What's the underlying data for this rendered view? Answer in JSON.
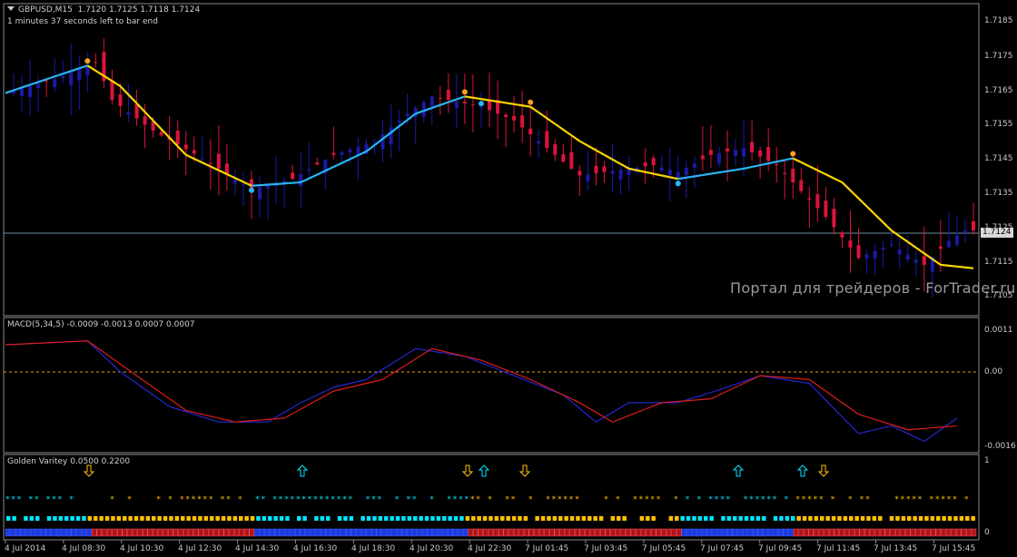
{
  "symbol_header": {
    "symbol": "GBPUSD,M15",
    "ohlc": "1.7120 1.7125 1.7118 1.7124",
    "timer": "1 minutes 37 seconds left to bar end"
  },
  "current_price": "1.7124",
  "watermark": "Портал для трейдеров - ForTrader.ru",
  "colors": {
    "background": "#000000",
    "bull_candle": "#1a1aa6",
    "bear_candle": "#dc143c",
    "ma_up": "#29b6f6",
    "ma_down": "#ffd700",
    "macd_line": "#2525d0",
    "signal_line": "#e01c1c",
    "zero_line": "#e0a020",
    "bid_line": "#6a8ca0"
  },
  "price_axis": [
    "1.7185",
    "1.7175",
    "1.7165",
    "1.7155",
    "1.7145",
    "1.7135",
    "1.7125",
    "1.7115",
    "1.7105"
  ],
  "macd_panel": {
    "label": "MACD(5,34,5) -0.0009 -0.0013 0.0007 0.0007",
    "axis": [
      "0.0011",
      "0.00",
      "-0.0016"
    ]
  },
  "golden_panel": {
    "label": "Golden Varitey 0.0500 0.2200",
    "axis": [
      "1",
      "0"
    ]
  },
  "time_axis": [
    "4 Jul 2014",
    "4 Jul 08:30",
    "4 Jul 10:30",
    "4 Jul 12:30",
    "4 Jul 14:30",
    "4 Jul 16:30",
    "4 Jul 18:30",
    "4 Jul 20:30",
    "4 Jul 22:30",
    "7 Jul 01:45",
    "7 Jul 03:45",
    "7 Jul 05:45",
    "7 Jul 07:45",
    "7 Jul 09:45",
    "7 Jul 11:45",
    "7 Jul 13:45",
    "7 Jul 15:45"
  ],
  "chart_data": {
    "type": "candlestick",
    "price_range": [
      1.7101,
      1.719
    ],
    "bars_count": 85,
    "close_path": [
      [
        0,
        1.7164
      ],
      [
        6,
        1.7168
      ],
      [
        11,
        1.7173
      ],
      [
        13,
        1.7162
      ],
      [
        18,
        1.7153
      ],
      [
        24,
        1.7145
      ],
      [
        30,
        1.7136
      ],
      [
        35,
        1.7139
      ],
      [
        40,
        1.7146
      ],
      [
        45,
        1.715
      ],
      [
        49,
        1.7158
      ],
      [
        52,
        1.7163
      ],
      [
        58,
        1.716
      ],
      [
        62,
        1.7156
      ],
      [
        66,
        1.7148
      ],
      [
        70,
        1.714
      ],
      [
        73,
        1.7141
      ],
      [
        79,
        1.7143
      ],
      [
        82,
        1.7141
      ],
      [
        86,
        1.7146
      ],
      [
        90,
        1.7148
      ],
      [
        94,
        1.7143
      ],
      [
        100,
        1.7128
      ],
      [
        104,
        1.7116
      ],
      [
        108,
        1.712
      ],
      [
        112,
        1.7114
      ],
      [
        115,
        1.7121
      ],
      [
        117,
        1.7124
      ]
    ],
    "ma_path": [
      [
        0,
        1.7164
      ],
      [
        10,
        1.7172
      ],
      [
        14,
        1.7166
      ],
      [
        22,
        1.7146
      ],
      [
        30,
        1.7137
      ],
      [
        36,
        1.7138
      ],
      [
        44,
        1.7147
      ],
      [
        50,
        1.7158
      ],
      [
        56,
        1.7163
      ],
      [
        64,
        1.716
      ],
      [
        70,
        1.715
      ],
      [
        76,
        1.7142
      ],
      [
        82,
        1.7139
      ],
      [
        90,
        1.7142
      ],
      [
        96,
        1.7145
      ],
      [
        102,
        1.7138
      ],
      [
        108,
        1.7124
      ],
      [
        114,
        1.7114
      ],
      [
        118,
        1.7113
      ]
    ],
    "ma_down_segments": [
      [
        10,
        30
      ],
      [
        56,
        82
      ],
      [
        96,
        118
      ]
    ],
    "macd": {
      "macd_path": [
        [
          0,
          0.0009
        ],
        [
          10,
          0.001
        ],
        [
          14,
          0.0002
        ],
        [
          20,
          -0.0007
        ],
        [
          26,
          -0.0011
        ],
        [
          32,
          -0.0011
        ],
        [
          36,
          -0.0006
        ],
        [
          40,
          -0.0002
        ],
        [
          44,
          0.0
        ],
        [
          50,
          0.0008
        ],
        [
          56,
          0.0006
        ],
        [
          62,
          0.0001
        ],
        [
          68,
          -0.0004
        ],
        [
          72,
          -0.0011
        ],
        [
          76,
          -0.0006
        ],
        [
          82,
          -0.0006
        ],
        [
          88,
          -0.0002
        ],
        [
          92,
          0.0001
        ],
        [
          98,
          -0.0001
        ],
        [
          104,
          -0.0014
        ],
        [
          108,
          -0.0012
        ],
        [
          112,
          -0.0016
        ],
        [
          116,
          -0.001
        ]
      ],
      "signal_path": [
        [
          0,
          0.0009
        ],
        [
          10,
          0.001
        ],
        [
          16,
          0.0001
        ],
        [
          22,
          -0.0008
        ],
        [
          28,
          -0.0011
        ],
        [
          34,
          -0.001
        ],
        [
          40,
          -0.0003
        ],
        [
          46,
          0.0
        ],
        [
          52,
          0.0008
        ],
        [
          58,
          0.0005
        ],
        [
          64,
          0.0
        ],
        [
          70,
          -0.0006
        ],
        [
          74,
          -0.0011
        ],
        [
          80,
          -0.0006
        ],
        [
          86,
          -0.0005
        ],
        [
          92,
          0.0001
        ],
        [
          98,
          0.0
        ],
        [
          104,
          -0.0009
        ],
        [
          110,
          -0.0013
        ],
        [
          116,
          -0.0012
        ]
      ],
      "range": [
        -0.0018,
        0.0013
      ]
    }
  }
}
